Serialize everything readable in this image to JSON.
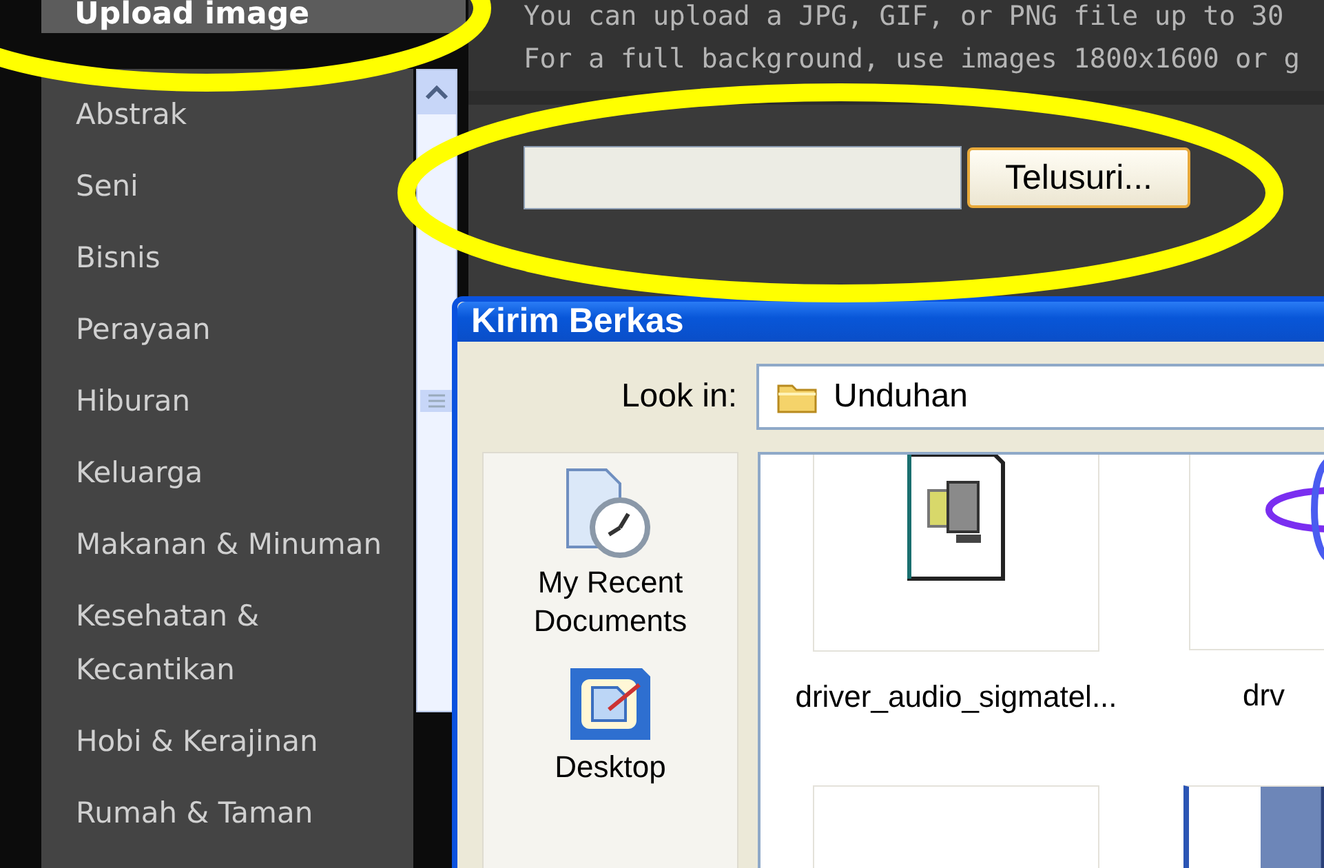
{
  "sidebar": {
    "header": "Upload image",
    "items": [
      {
        "label": "Abstrak"
      },
      {
        "label": "Seni"
      },
      {
        "label": "Bisnis"
      },
      {
        "label": "Perayaan"
      },
      {
        "label": "Hiburan"
      },
      {
        "label": "Keluarga"
      },
      {
        "label": "Makanan & Minuman"
      },
      {
        "label": "Kesehatan & Kecantikan"
      },
      {
        "label": "Hobi & Kerajinan"
      },
      {
        "label": "Rumah & Taman"
      }
    ]
  },
  "upload": {
    "lines": [
      "You can upload a JPG, GIF, or PNG file up to 30",
      "For a full background, use images 1800x1600 or g"
    ],
    "browse_button": "Telusuri..."
  },
  "dialog": {
    "title": "Kirim Berkas",
    "look_in_label": "Look in:",
    "look_in_value": "Unduhan",
    "places": [
      {
        "label": "My Recent Documents",
        "kind": "recent"
      },
      {
        "label": "Desktop",
        "kind": "desktop"
      }
    ],
    "files": [
      {
        "name": "driver_audio_sigmatel...",
        "kind": "installer",
        "selected": false
      },
      {
        "name": "drv",
        "kind": "orbit",
        "selected": false
      },
      {
        "kind": "blank",
        "selected": false
      },
      {
        "kind": "picture",
        "selected": true
      }
    ]
  },
  "annotations": [
    {
      "kind": "ellipse"
    },
    {
      "kind": "ellipse"
    }
  ]
}
